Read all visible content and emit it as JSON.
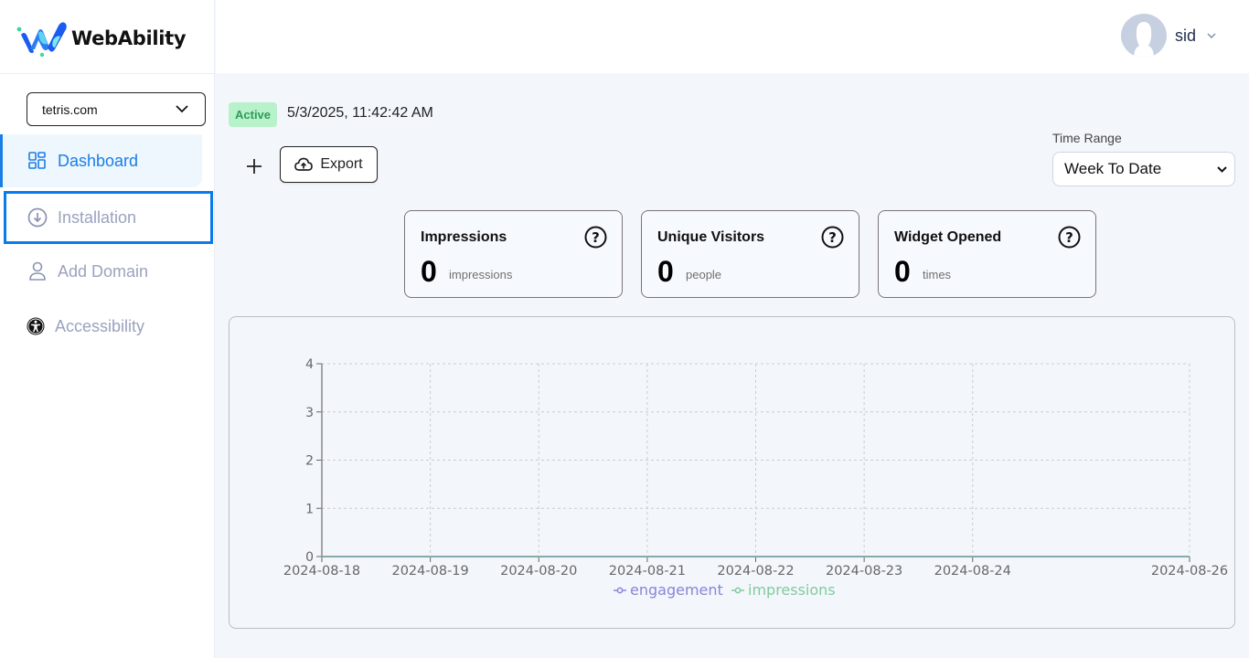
{
  "brand": {
    "name": "WebAbility",
    "colors": {
      "blue": "#1a5cf0",
      "cyan": "#5fe0f0",
      "green": "#3fd6a0"
    }
  },
  "sidebar": {
    "domain_select": {
      "value": "tetris.com"
    },
    "items": [
      {
        "label": "Dashboard",
        "icon": "dashboard-grid-icon",
        "state": "active"
      },
      {
        "label": "Installation",
        "icon": "download-circle-icon",
        "state": "focused"
      },
      {
        "label": "Add Domain",
        "icon": "user-icon",
        "state": "default"
      },
      {
        "label": "Accessibility",
        "icon": "accessibility-icon",
        "state": "default"
      }
    ]
  },
  "topbar": {
    "user": {
      "name": "sid"
    }
  },
  "main": {
    "status": "Active",
    "timestamp": "5/3/2025, 11:42:42 AM",
    "export_label": "Export",
    "time_range": {
      "label": "Time Range",
      "value": "Week To Date"
    },
    "stats": [
      {
        "title": "Impressions",
        "value": "0",
        "unit": "impressions"
      },
      {
        "title": "Unique Visitors",
        "value": "0",
        "unit": "people"
      },
      {
        "title": "Widget Opened",
        "value": "0",
        "unit": "times"
      }
    ]
  },
  "chart_data": {
    "type": "line",
    "title": "",
    "xlabel": "",
    "ylabel": "",
    "x": [
      "2024-08-18",
      "2024-08-19",
      "2024-08-20",
      "2024-08-21",
      "2024-08-22",
      "2024-08-23",
      "2024-08-24",
      "2024-08-26"
    ],
    "x_positions_days": [
      0,
      1,
      2,
      3,
      4,
      5,
      6,
      8
    ],
    "ylim": [
      0,
      4
    ],
    "yticks": [
      0,
      1,
      2,
      3,
      4
    ],
    "grid": true,
    "legend": "bottom-center",
    "series": [
      {
        "name": "engagement",
        "color": "#8884d8",
        "values": [
          0,
          0,
          0,
          0,
          0,
          0,
          0,
          0
        ]
      },
      {
        "name": "impressions",
        "color": "#82ca9d",
        "values": [
          0,
          0,
          0,
          0,
          0,
          0,
          0,
          0
        ]
      }
    ]
  }
}
